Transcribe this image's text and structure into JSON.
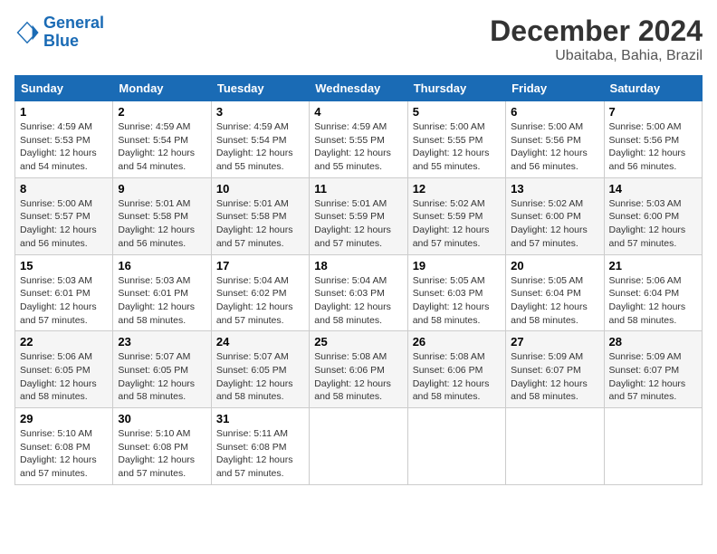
{
  "header": {
    "logo_line1": "General",
    "logo_line2": "Blue",
    "month": "December 2024",
    "location": "Ubaitaba, Bahia, Brazil"
  },
  "columns": [
    "Sunday",
    "Monday",
    "Tuesday",
    "Wednesday",
    "Thursday",
    "Friday",
    "Saturday"
  ],
  "weeks": [
    [
      {
        "day": "1",
        "sunrise": "4:59 AM",
        "sunset": "5:53 PM",
        "daylight": "12 hours and 54 minutes."
      },
      {
        "day": "2",
        "sunrise": "4:59 AM",
        "sunset": "5:54 PM",
        "daylight": "12 hours and 54 minutes."
      },
      {
        "day": "3",
        "sunrise": "4:59 AM",
        "sunset": "5:54 PM",
        "daylight": "12 hours and 55 minutes."
      },
      {
        "day": "4",
        "sunrise": "4:59 AM",
        "sunset": "5:55 PM",
        "daylight": "12 hours and 55 minutes."
      },
      {
        "day": "5",
        "sunrise": "5:00 AM",
        "sunset": "5:55 PM",
        "daylight": "12 hours and 55 minutes."
      },
      {
        "day": "6",
        "sunrise": "5:00 AM",
        "sunset": "5:56 PM",
        "daylight": "12 hours and 56 minutes."
      },
      {
        "day": "7",
        "sunrise": "5:00 AM",
        "sunset": "5:56 PM",
        "daylight": "12 hours and 56 minutes."
      }
    ],
    [
      {
        "day": "8",
        "sunrise": "5:00 AM",
        "sunset": "5:57 PM",
        "daylight": "12 hours and 56 minutes."
      },
      {
        "day": "9",
        "sunrise": "5:01 AM",
        "sunset": "5:58 PM",
        "daylight": "12 hours and 56 minutes."
      },
      {
        "day": "10",
        "sunrise": "5:01 AM",
        "sunset": "5:58 PM",
        "daylight": "12 hours and 57 minutes."
      },
      {
        "day": "11",
        "sunrise": "5:01 AM",
        "sunset": "5:59 PM",
        "daylight": "12 hours and 57 minutes."
      },
      {
        "day": "12",
        "sunrise": "5:02 AM",
        "sunset": "5:59 PM",
        "daylight": "12 hours and 57 minutes."
      },
      {
        "day": "13",
        "sunrise": "5:02 AM",
        "sunset": "6:00 PM",
        "daylight": "12 hours and 57 minutes."
      },
      {
        "day": "14",
        "sunrise": "5:03 AM",
        "sunset": "6:00 PM",
        "daylight": "12 hours and 57 minutes."
      }
    ],
    [
      {
        "day": "15",
        "sunrise": "5:03 AM",
        "sunset": "6:01 PM",
        "daylight": "12 hours and 57 minutes."
      },
      {
        "day": "16",
        "sunrise": "5:03 AM",
        "sunset": "6:01 PM",
        "daylight": "12 hours and 58 minutes."
      },
      {
        "day": "17",
        "sunrise": "5:04 AM",
        "sunset": "6:02 PM",
        "daylight": "12 hours and 57 minutes."
      },
      {
        "day": "18",
        "sunrise": "5:04 AM",
        "sunset": "6:03 PM",
        "daylight": "12 hours and 58 minutes."
      },
      {
        "day": "19",
        "sunrise": "5:05 AM",
        "sunset": "6:03 PM",
        "daylight": "12 hours and 58 minutes."
      },
      {
        "day": "20",
        "sunrise": "5:05 AM",
        "sunset": "6:04 PM",
        "daylight": "12 hours and 58 minutes."
      },
      {
        "day": "21",
        "sunrise": "5:06 AM",
        "sunset": "6:04 PM",
        "daylight": "12 hours and 58 minutes."
      }
    ],
    [
      {
        "day": "22",
        "sunrise": "5:06 AM",
        "sunset": "6:05 PM",
        "daylight": "12 hours and 58 minutes."
      },
      {
        "day": "23",
        "sunrise": "5:07 AM",
        "sunset": "6:05 PM",
        "daylight": "12 hours and 58 minutes."
      },
      {
        "day": "24",
        "sunrise": "5:07 AM",
        "sunset": "6:05 PM",
        "daylight": "12 hours and 58 minutes."
      },
      {
        "day": "25",
        "sunrise": "5:08 AM",
        "sunset": "6:06 PM",
        "daylight": "12 hours and 58 minutes."
      },
      {
        "day": "26",
        "sunrise": "5:08 AM",
        "sunset": "6:06 PM",
        "daylight": "12 hours and 58 minutes."
      },
      {
        "day": "27",
        "sunrise": "5:09 AM",
        "sunset": "6:07 PM",
        "daylight": "12 hours and 58 minutes."
      },
      {
        "day": "28",
        "sunrise": "5:09 AM",
        "sunset": "6:07 PM",
        "daylight": "12 hours and 57 minutes."
      }
    ],
    [
      {
        "day": "29",
        "sunrise": "5:10 AM",
        "sunset": "6:08 PM",
        "daylight": "12 hours and 57 minutes."
      },
      {
        "day": "30",
        "sunrise": "5:10 AM",
        "sunset": "6:08 PM",
        "daylight": "12 hours and 57 minutes."
      },
      {
        "day": "31",
        "sunrise": "5:11 AM",
        "sunset": "6:08 PM",
        "daylight": "12 hours and 57 minutes."
      },
      null,
      null,
      null,
      null
    ]
  ]
}
